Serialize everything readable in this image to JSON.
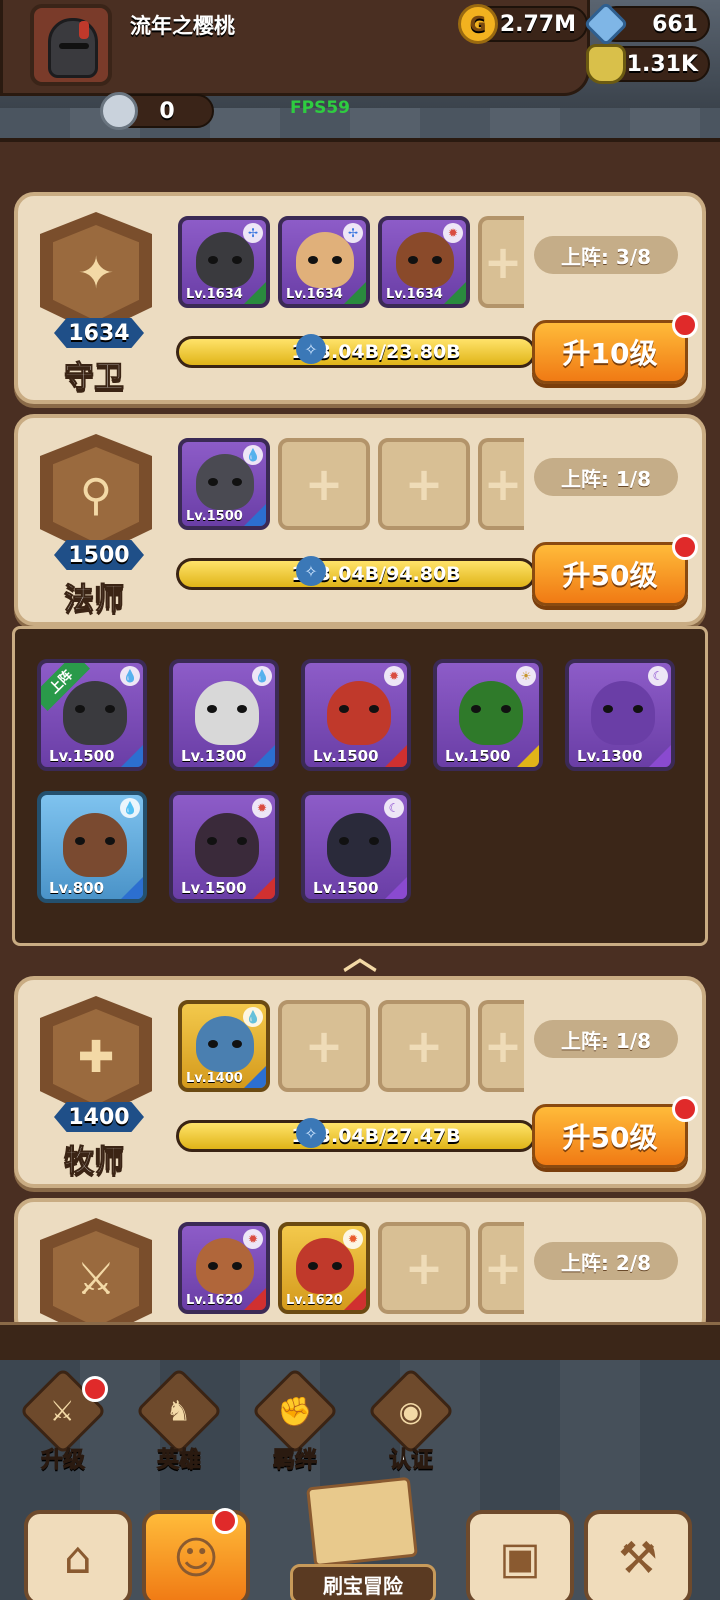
{
  "header": {
    "username": "流年之樱桃",
    "gold": "2.77M",
    "gems": "661",
    "potion": "1.31K",
    "silver": "0",
    "fps": "FPS59"
  },
  "classes": [
    {
      "key": "guardian",
      "role": "守卫",
      "level": "1634",
      "deploy": "上阵: 3/8",
      "progress_text": "113.04B/23.80B",
      "progress_fraction": 1.0,
      "upgrade": "升10级",
      "heroes": [
        {
          "lv": "Lv.1634"
        },
        {
          "lv": "Lv.1634"
        },
        {
          "lv": "Lv.1634"
        }
      ]
    },
    {
      "key": "mage",
      "role": "法师",
      "level": "1500",
      "deploy": "上阵: 1/8",
      "progress_text": "113.04B/94.80B",
      "progress_fraction": 1.0,
      "upgrade": "升50级",
      "heroes": [
        {
          "lv": "Lv.1500"
        }
      ]
    },
    {
      "key": "priest",
      "role": "牧师",
      "level": "1400",
      "deploy": "上阵: 1/8",
      "progress_text": "113.04B/27.47B",
      "progress_fraction": 1.0,
      "upgrade": "升50级",
      "heroes": [
        {
          "lv": "Lv.1400"
        }
      ]
    },
    {
      "key": "warrior",
      "deploy": "上阵: 2/8",
      "heroes": [
        {
          "lv": "Lv.1620"
        },
        {
          "lv": "Lv.1620"
        }
      ]
    }
  ],
  "roster": {
    "deployed_tag": "上阵",
    "heroes": [
      {
        "lv": "Lv.1500",
        "color": "purple",
        "face": "#3a3a3e"
      },
      {
        "lv": "Lv.1300",
        "color": "purple",
        "face": "#d8d8d8"
      },
      {
        "lv": "Lv.1500",
        "color": "purple",
        "face": "#c0392b"
      },
      {
        "lv": "Lv.1500",
        "color": "purple",
        "face": "#2f7a2a"
      },
      {
        "lv": "Lv.1300",
        "color": "purple",
        "face": "#6a3ea6"
      },
      {
        "lv": "Lv.800",
        "color": "blue",
        "face": "#7a4a30"
      },
      {
        "lv": "Lv.1500",
        "color": "purple",
        "face": "#3a2a3a"
      },
      {
        "lv": "Lv.1500",
        "color": "purple",
        "face": "#2a2a3a"
      }
    ]
  },
  "tabs": [
    "升级",
    "英雄",
    "羁绊",
    "认证"
  ],
  "adventure_label": "刷宝冒险",
  "add_symbol": "+",
  "colors": {
    "accent": "#f07a14",
    "badge": "#1f4f88",
    "alert": "#e02a2a"
  }
}
